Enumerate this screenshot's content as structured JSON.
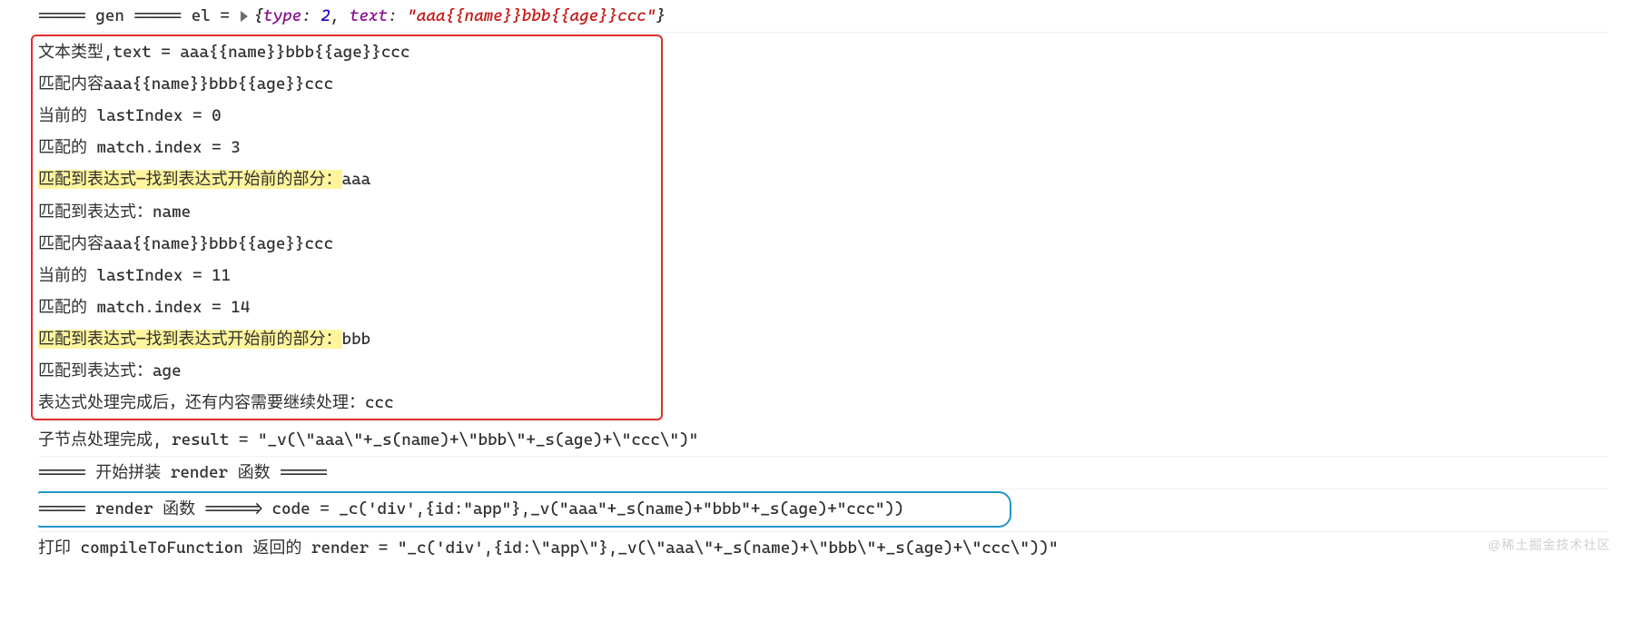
{
  "topline": {
    "prefix": "===== gen ===== el = ",
    "brace_open": "{",
    "type_key": "type",
    "type_val": "2",
    "text_key": "text",
    "text_val": "\"aaa{{name}}bbb{{age}}ccc\"",
    "brace_close": "}"
  },
  "redbox": {
    "lines": [
      {
        "text": "文本类型,text = aaa{{name}}bbb{{age}}ccc"
      },
      {
        "text": "匹配内容aaa{{name}}bbb{{age}}ccc"
      },
      {
        "text": "当前的 lastIndex = 0"
      },
      {
        "text": "匹配的 match.index = 3"
      },
      {
        "hl": "匹配到表达式—找到表达式开始前的部分：",
        "rest": "aaa"
      },
      {
        "text": "匹配到表达式：name"
      },
      {
        "text": "匹配内容aaa{{name}}bbb{{age}}ccc"
      },
      {
        "text": "当前的 lastIndex = 11"
      },
      {
        "text": "匹配的 match.index = 14"
      },
      {
        "hl": "匹配到表达式—找到表达式开始前的部分：",
        "rest": "bbb"
      },
      {
        "text": "匹配到表达式：age"
      },
      {
        "text": "表达式处理完成后，还有内容需要继续处理：ccc"
      }
    ]
  },
  "after": {
    "result_line": "子节点处理完成, result = \"_v(\\\"aaa\\\"+_s(name)+\\\"bbb\\\"+_s(age)+\\\"ccc\\\")\"",
    "splice_header": "===== 开始拼装 render 函数 =====",
    "blue_line": "===== render 函数 =====> code = _c('div',{id:\"app\"},_v(\"aaa\"+_s(name)+\"bbb\"+_s(age)+\"ccc\"))",
    "print_line": "打印 compileToFunction 返回的 render = \"_c('div',{id:\\\"app\\\"},_v(\\\"aaa\\\"+_s(name)+\\\"bbb\\\"+_s(age)+\\\"ccc\\\"))\""
  },
  "watermark": "@稀土掘金技术社区"
}
